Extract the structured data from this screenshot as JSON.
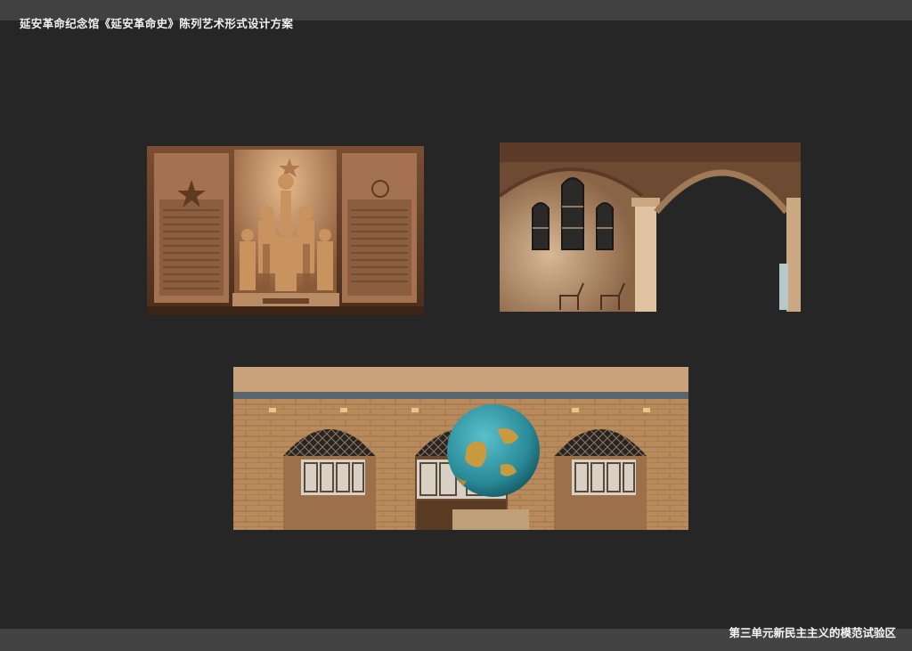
{
  "header": {
    "title": "延安革命纪念馆《延安革命史》陈列艺术形式设计方案"
  },
  "footer": {
    "caption": "第三单元新民主主义的模范试验区"
  },
  "renderings": [
    {
      "subject": "bronze-sculpture-wall"
    },
    {
      "subject": "arched-hall-interior"
    },
    {
      "subject": "cave-dwelling-facade-with-globe"
    }
  ],
  "colors": {
    "background": "#262626",
    "bars": "#414141",
    "wall_tan": "#b88a5c",
    "globe_sea": "#2a8a98",
    "globe_land": "#c99a40"
  }
}
